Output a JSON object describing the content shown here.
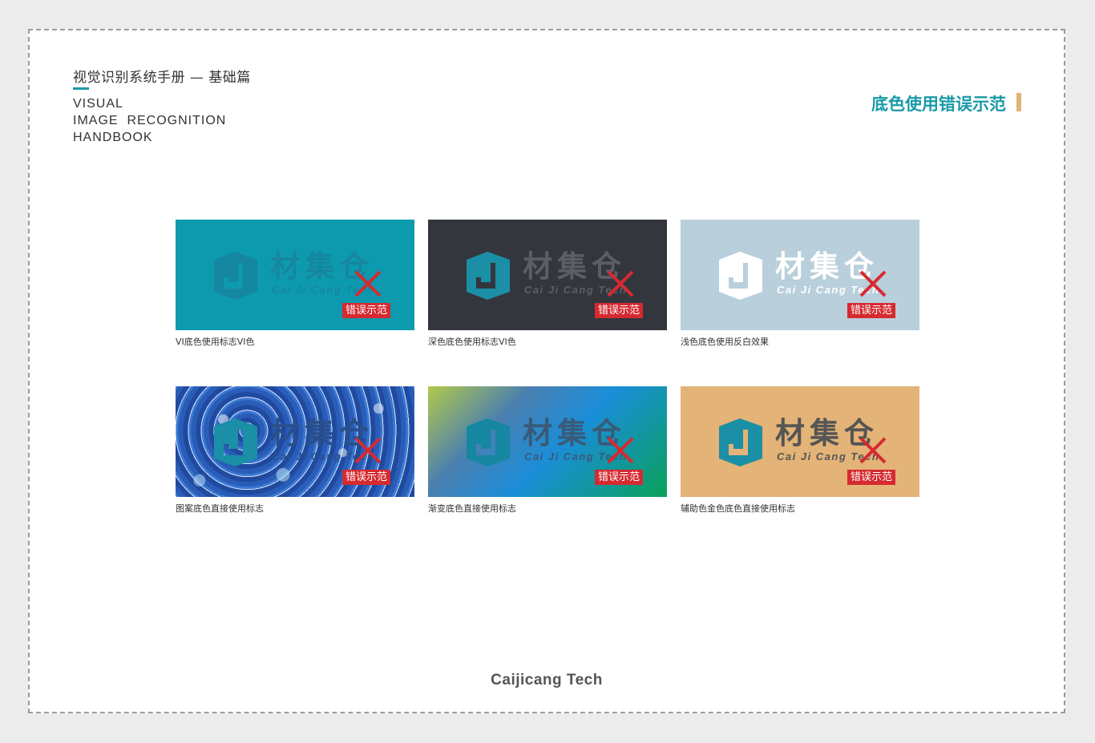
{
  "header": {
    "title_cn": "视觉识别系统手册 — 基础篇",
    "title_en_lines": [
      "VISUAL",
      "IMAGE  RECOGNITION",
      "HANDBOOK"
    ]
  },
  "section": {
    "title": "底色使用错误示范",
    "accent_color": "#1a9aa8",
    "bar_color": "#e1b377"
  },
  "logo": {
    "name_cn": "材集仓",
    "name_en": "Cai Ji Cang Tech"
  },
  "badge_label": "错误示范",
  "cards": [
    {
      "caption": "VI底色使用标志VI色",
      "background": "#0e9aae",
      "logo_color": "#1687a0",
      "text_color": "#1687a0"
    },
    {
      "caption": "深色底色使用标志VI色",
      "background": "#33363d",
      "logo_color": "#1a8fa6",
      "text_color": "#5a5f67"
    },
    {
      "caption": "浅色底色使用反白效果",
      "background": "#b9cfdb",
      "logo_color": "#ffffff",
      "text_color": "#ffffff"
    },
    {
      "caption": "图案底色直接使用标志",
      "background": "pattern",
      "logo_color": "#1a8fa6",
      "text_color": "#2a4f8a"
    },
    {
      "caption": "渐变底色直接使用标志",
      "background": "gradient",
      "logo_color": "#1687a0",
      "text_color": "#3a5a78"
    },
    {
      "caption": "辅助色金色底色直接使用标志",
      "background": "#e3b377",
      "logo_color": "#1a8fa6",
      "text_color": "#555555"
    }
  ],
  "footer": {
    "brand": "Caijicang Tech"
  }
}
